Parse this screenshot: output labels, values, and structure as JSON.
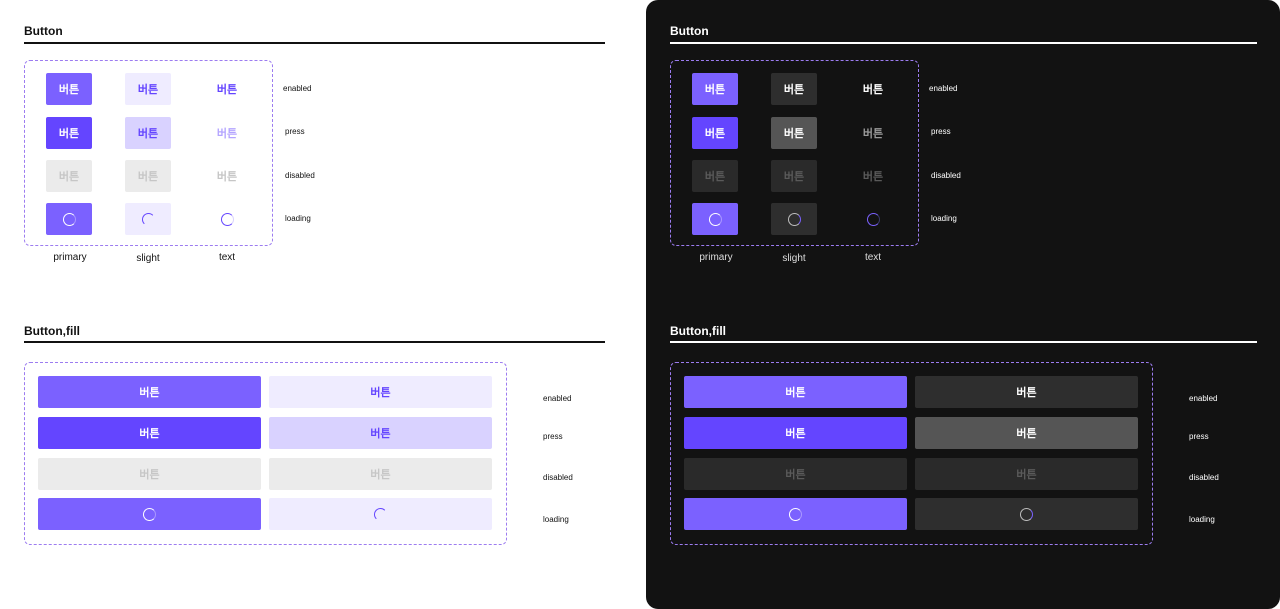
{
  "colors": {
    "accent": "#7b61ff",
    "accent_press": "#6445ff",
    "dashed_border": "#9c7cf0",
    "dark_bg": "#121212"
  },
  "sections": {
    "button_title": "Button",
    "fill_title": "Button,fill"
  },
  "button_label": "버튼",
  "states": {
    "enabled": "enabled",
    "press": "press",
    "disabled": "disabled",
    "loading": "loading"
  },
  "columns": {
    "primary": "primary",
    "slight": "slight",
    "text": "text"
  },
  "light": {
    "title": "Button",
    "fill_title": "Button,fill"
  },
  "dark": {
    "title": "Button",
    "fill_title": "Button,fill"
  }
}
